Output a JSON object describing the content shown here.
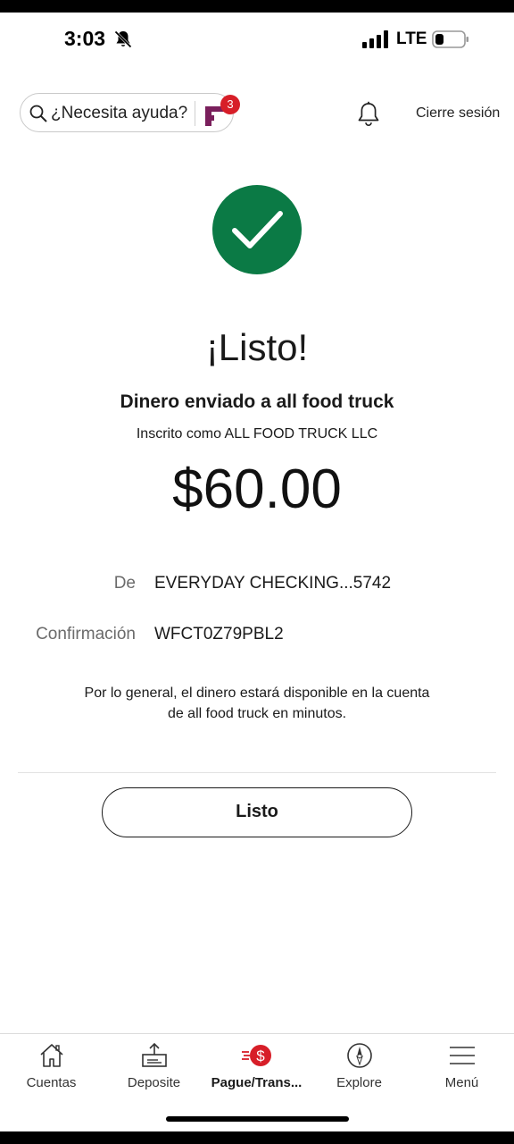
{
  "status_bar": {
    "time": "3:03",
    "network": "LTE"
  },
  "header": {
    "search_label": "¿Necesita ayuda?",
    "assistant_badge_count": "3",
    "sign_out": "Cierre sesión"
  },
  "confirmation": {
    "title": "¡Listo!",
    "sent_to": "Dinero enviado a all food truck",
    "enrolled_as": "Inscrito como ALL FOOD TRUCK LLC",
    "amount": "$60.00",
    "from_label": "De",
    "from_value": "EVERYDAY CHECKING...5742",
    "confirmation_label": "Confirmación",
    "confirmation_value": "WFCT0Z79PBL2",
    "disclaimer_line1": "Por lo general, el dinero estará disponible en la cuenta",
    "disclaimer_line2": "de all food truck en minutos.",
    "done_button": "Listo"
  },
  "bottom_nav": {
    "items": [
      {
        "label": "Cuentas",
        "icon": "home-icon"
      },
      {
        "label": "Deposite",
        "icon": "deposit-icon"
      },
      {
        "label": "Pague/Trans...",
        "icon": "pay-transfer-icon",
        "active": true
      },
      {
        "label": "Explore",
        "icon": "compass-icon"
      },
      {
        "label": "Menú",
        "icon": "hamburger-menu-icon"
      }
    ]
  },
  "colors": {
    "success_green": "#0b7a45",
    "brand_red": "#d71e28",
    "fargo_purple": "#7a1f5c"
  }
}
